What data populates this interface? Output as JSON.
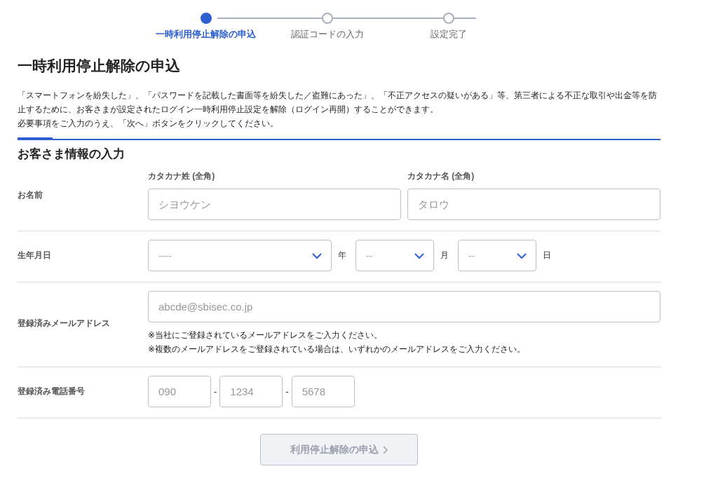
{
  "steps": [
    {
      "label": "一時利用停止解除の申込",
      "selected": true
    },
    {
      "label": "認証コードの入力",
      "selected": false
    },
    {
      "label": "設定完了",
      "selected": false
    }
  ],
  "title": "一時利用停止解除の申込",
  "intro": [
    "「スマートフォンを紛失した」、「パスワードを記載した書面等を紛失した／盗難にあった」、「不正アクセスの疑いがある」等、第三者による不正な取引や出金等を防止するために、お客さまが設定されたログイン一時利用停止設定を解除（ログイン再開）することができます。",
    "必要事項をご入力のうえ、「次へ」ボタンをクリックしてください。"
  ],
  "section_title": "お客さま情報の入力",
  "rows": [
    {
      "kind": "name",
      "label": "お名前",
      "fields": [
        {
          "label": "カタカナ姓 (全角)",
          "placeholder": "シヨウケン"
        },
        {
          "label": "カタカナ名 (全角)",
          "placeholder": "タロウ"
        }
      ]
    },
    {
      "kind": "date",
      "label": "生年月日",
      "fields": [
        {
          "value": "----",
          "unit": "年"
        },
        {
          "value": "--",
          "unit": "月"
        },
        {
          "value": "--",
          "unit": "日"
        }
      ]
    },
    {
      "kind": "email",
      "label": "登録済みメールアドレス",
      "fields": [
        {
          "placeholder": "abcde@sbisec.co.jp"
        }
      ],
      "notes": [
        "※当社にご登録されているメールアドレスをご入力ください。",
        "※複数のメールアドレスをご登録されている場合は、いずれかのメールアドレスをご入力ください。"
      ]
    },
    {
      "kind": "phone",
      "label": "登録済み電話番号",
      "fields": [
        {
          "placeholder": "090",
          "separator": "-"
        },
        {
          "placeholder": "1234",
          "separator": "-"
        },
        {
          "placeholder": "5678"
        }
      ]
    }
  ],
  "submit": {
    "label": "利用停止解除の申込",
    "disabled": true
  }
}
